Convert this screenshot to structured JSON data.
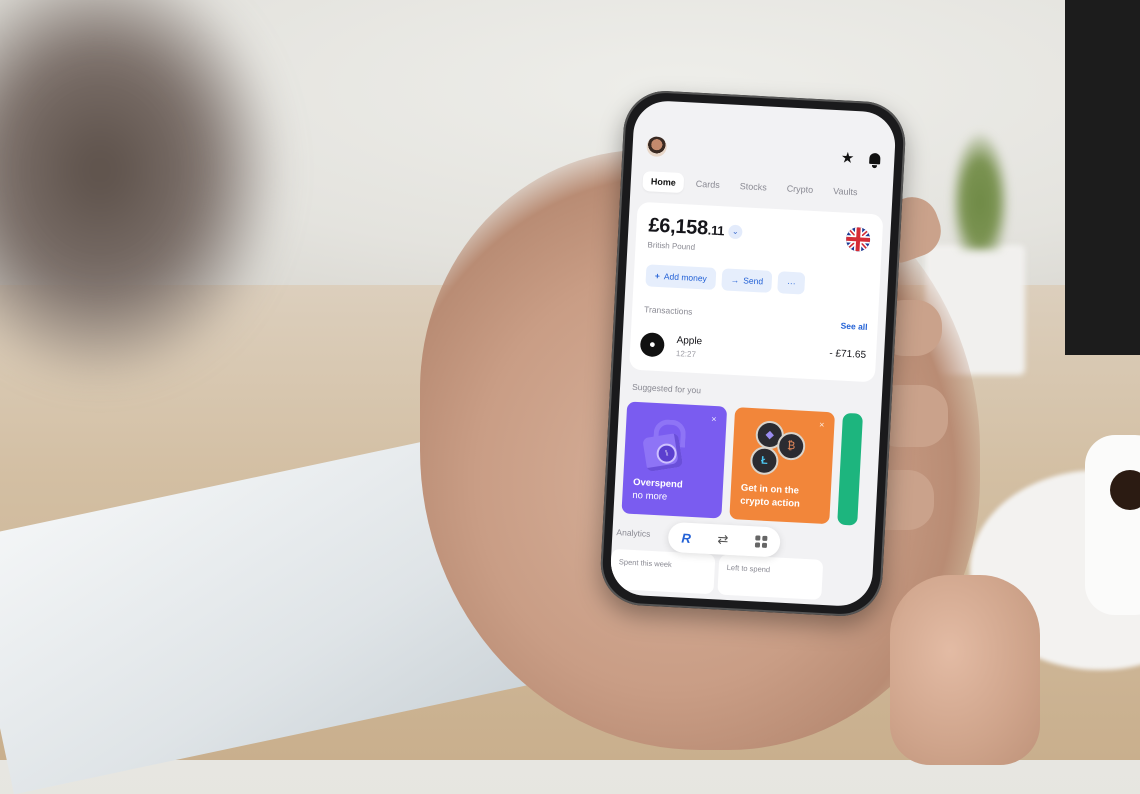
{
  "scene": {
    "description": "Hand holding a smartphone showing a banking app home screen",
    "colors": {
      "accent_blue": "#2462d6",
      "button_bg": "#e6eefc",
      "promo_purple": "#7a5cf0",
      "promo_orange": "#f2863a",
      "promo_green": "#1db57e",
      "screen_bg": "#f2f2f4"
    }
  },
  "app": {
    "header": {
      "avatar_icon": "user-avatar",
      "star_icon": "star-icon",
      "bell_icon": "bell-icon"
    },
    "tabs": [
      {
        "label": "Home",
        "active": true
      },
      {
        "label": "Cards",
        "active": false
      },
      {
        "label": "Stocks",
        "active": false
      },
      {
        "label": "Crypto",
        "active": false
      },
      {
        "label": "Vaults",
        "active": false
      }
    ],
    "account": {
      "balance_main": "£6,158",
      "balance_cents": ".11",
      "currency_name": "British Pound",
      "flag_icon": "uk-flag-icon",
      "dropdown_icon": "chevron-down-icon"
    },
    "actions": [
      {
        "icon": "+",
        "label": "Add money"
      },
      {
        "icon": "→",
        "label": "Send"
      },
      {
        "icon": "",
        "label": "···"
      }
    ],
    "transactions": {
      "title": "Transactions",
      "see_all": "See all",
      "items": [
        {
          "merchant": "Apple",
          "time": "12:27",
          "amount": "- £71.65",
          "logo_icon": "apple-logo-icon"
        }
      ]
    },
    "suggested": {
      "title": "Suggested for you",
      "cards": [
        {
          "text_line1": "Overspend",
          "text_line2": "no more",
          "close": "×",
          "illustration": "lock-icon"
        },
        {
          "text_line1": "Get in on the",
          "text_line2": "crypto action",
          "close": "×",
          "illustration": "crypto-coins-icon"
        }
      ]
    },
    "analytics": {
      "title": "Analytics",
      "stats": [
        {
          "label": "Spent this week"
        },
        {
          "label": "Left to spend"
        }
      ]
    },
    "bottom_nav": {
      "home_glyph": "R",
      "transfer_glyph": "⇄",
      "hub_icon": "grid-icon"
    }
  }
}
